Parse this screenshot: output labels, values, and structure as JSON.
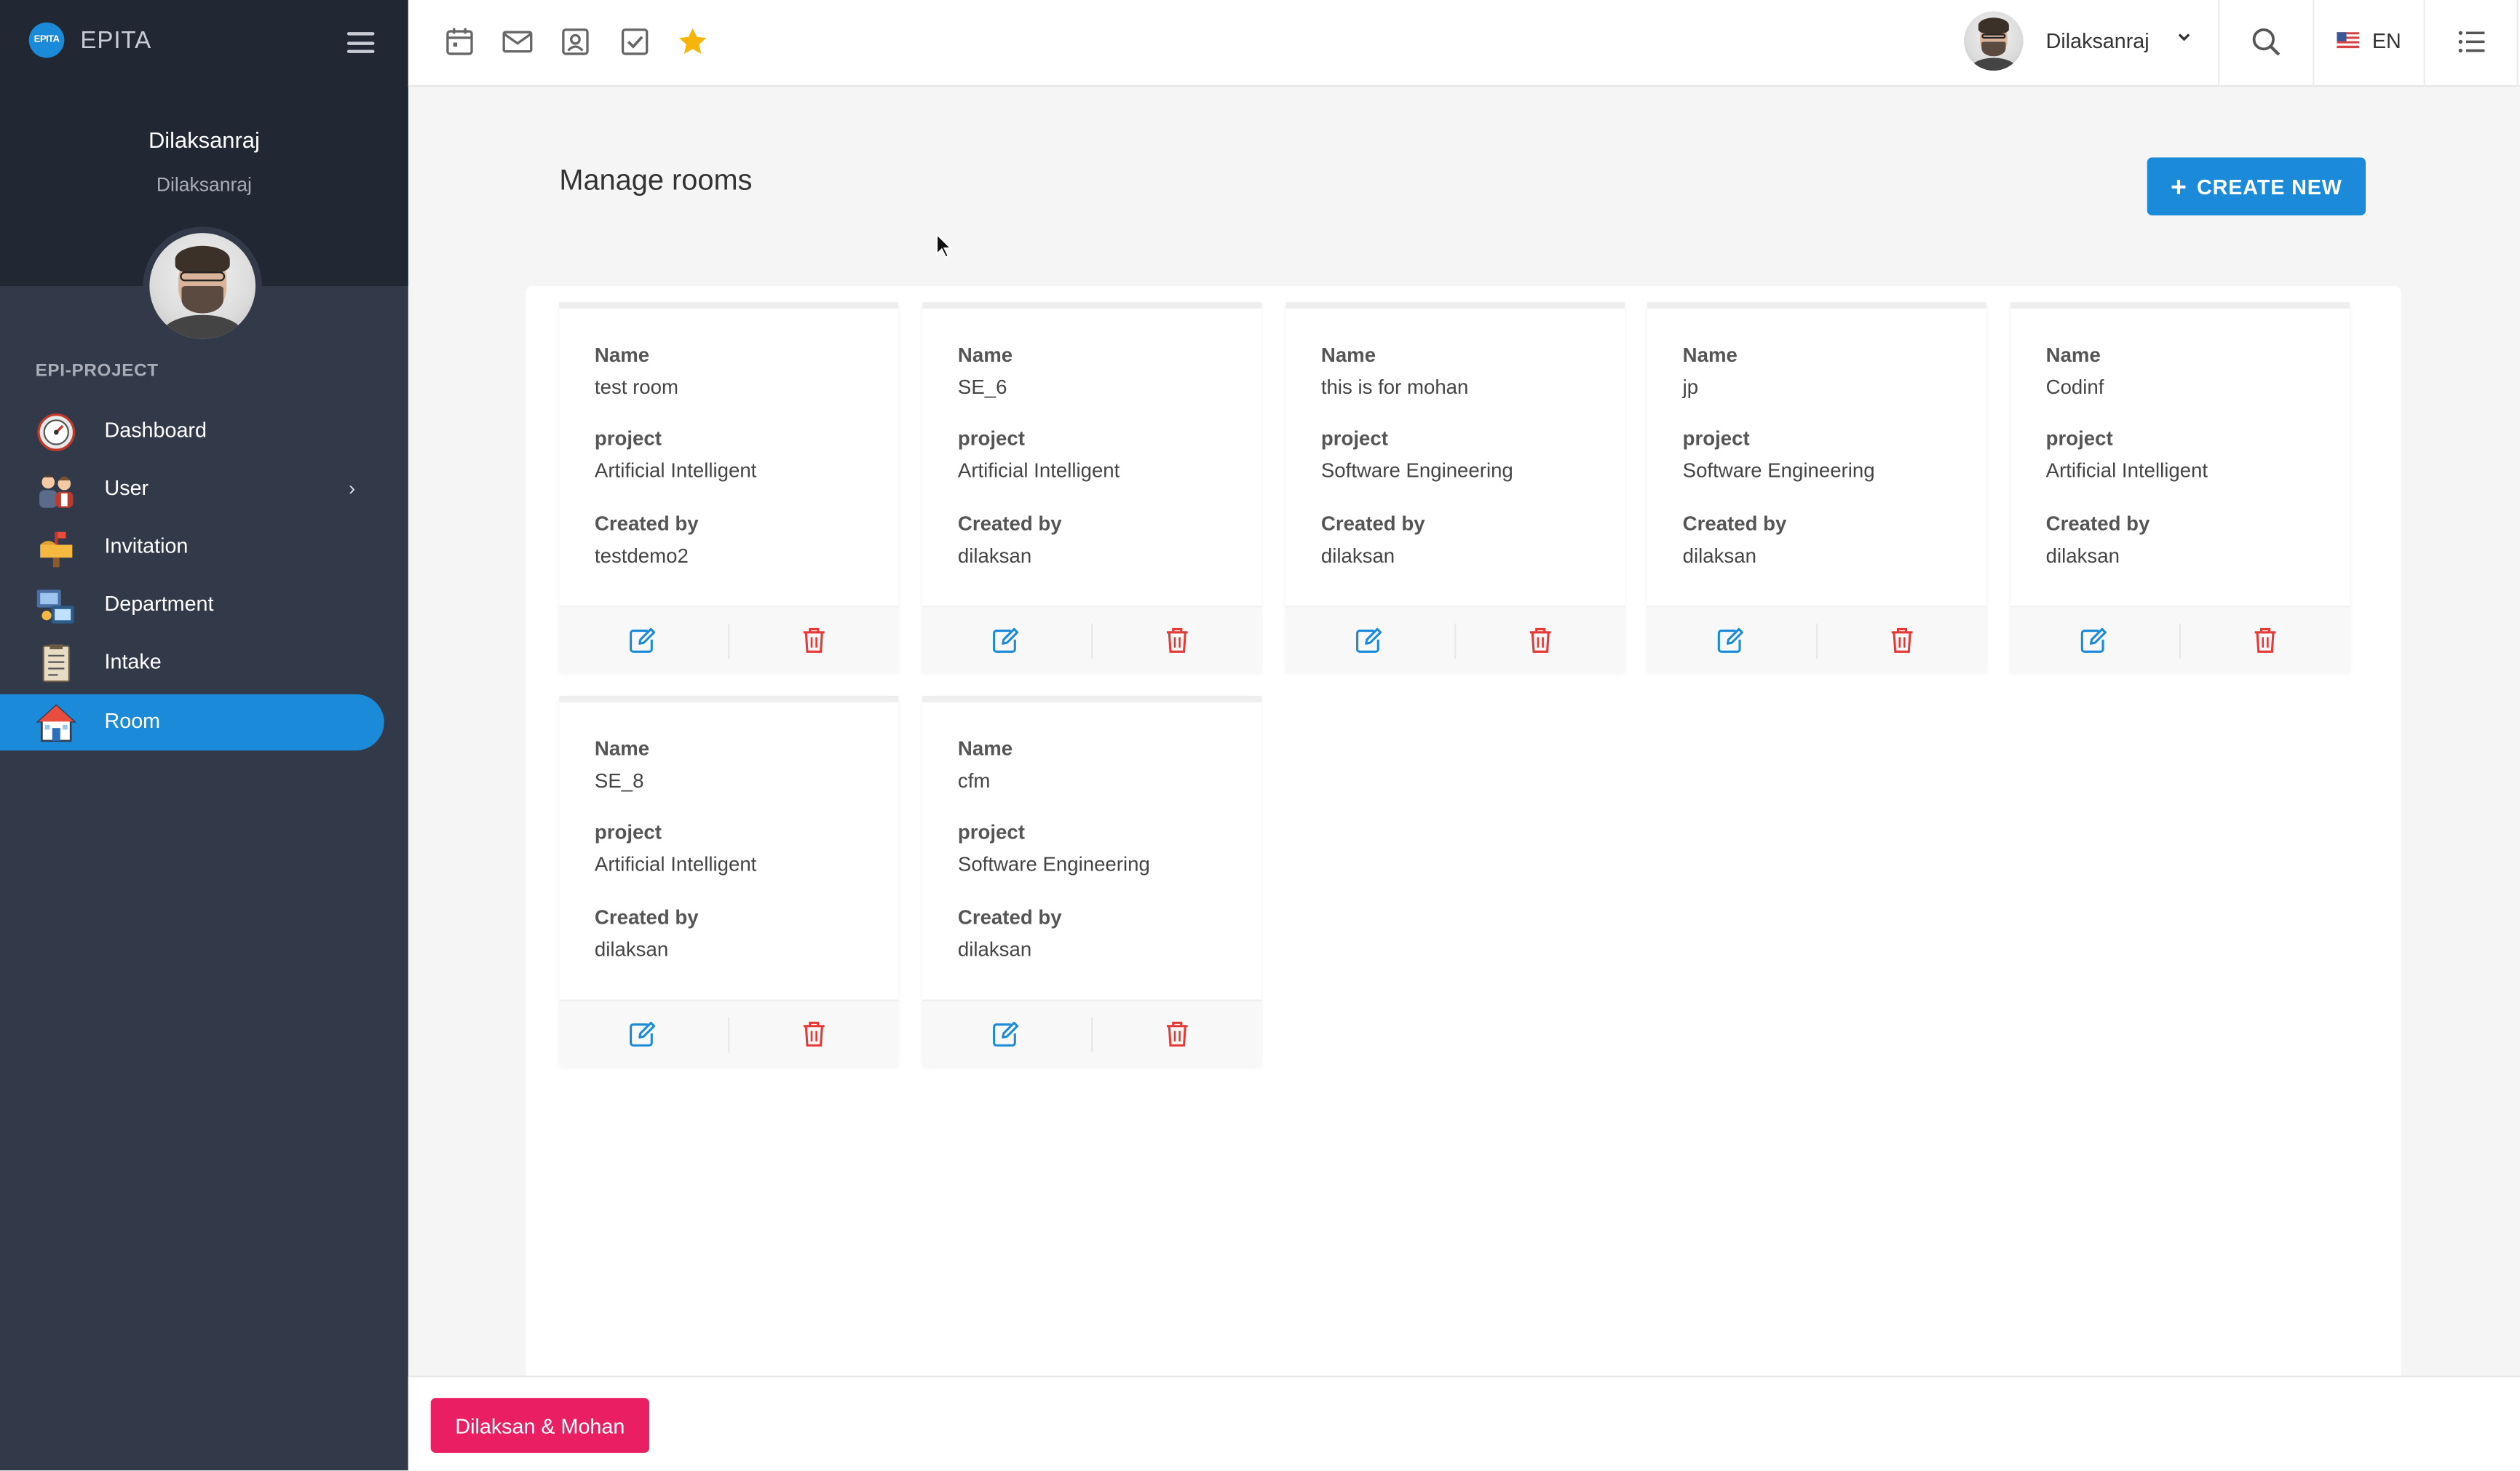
{
  "brand": {
    "name": "EPITA",
    "logo_text": "EPITA"
  },
  "profile": {
    "name": "Dilaksanraj",
    "subtitle": "Dilaksanraj"
  },
  "sidebar": {
    "section_title": "EPI-PROJECT",
    "items": [
      {
        "label": "Dashboard",
        "icon": "dashboard-gauge-icon"
      },
      {
        "label": "User",
        "icon": "users-icon"
      },
      {
        "label": "Invitation",
        "icon": "mailbox-icon"
      },
      {
        "label": "Department",
        "icon": "department-icon"
      },
      {
        "label": "Intake",
        "icon": "document-icon"
      },
      {
        "label": "Room",
        "icon": "house-icon"
      }
    ],
    "active_item": "Room"
  },
  "topbar": {
    "shortcut_icons": [
      "calendar-icon",
      "mail-icon",
      "contacts-icon",
      "tasks-icon",
      "star-icon"
    ],
    "user_name": "Dilaksanraj",
    "language": "EN"
  },
  "page": {
    "title": "Manage rooms",
    "create_button_label": "CREATE NEW"
  },
  "room_card_labels": {
    "name": "Name",
    "project": "project",
    "created_by": "Created by"
  },
  "rooms": [
    {
      "name": "test room",
      "project": "Artificial Intelligent",
      "created_by": "testdemo2"
    },
    {
      "name": "SE_6",
      "project": "Artificial Intelligent",
      "created_by": "dilaksan"
    },
    {
      "name": "this is for mohan",
      "project": "Software Engineering",
      "created_by": "dilaksan"
    },
    {
      "name": "jp",
      "project": "Software Engineering",
      "created_by": "dilaksan"
    },
    {
      "name": "Codinf",
      "project": "Artificial Intelligent",
      "created_by": "dilaksan"
    },
    {
      "name": "SE_8",
      "project": "Artificial Intelligent",
      "created_by": "dilaksan"
    },
    {
      "name": "cfm",
      "project": "Software Engineering",
      "created_by": "dilaksan"
    }
  ],
  "footer": {
    "button_label": "Dilaksan & Mohan"
  },
  "colors": {
    "primary": "#1b8ad8",
    "sidebar_bg": "#323a4a",
    "sidebar_header_bg": "#222833",
    "footer_button": "#e91e63",
    "delete_icon": "#e53935",
    "star_icon": "#f5b50a"
  }
}
